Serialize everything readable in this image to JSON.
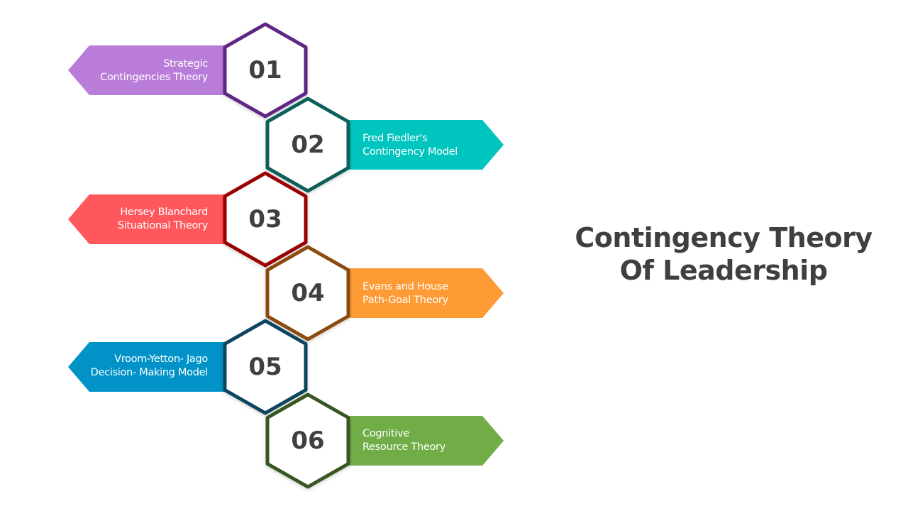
{
  "title": {
    "line1": "Contingency Theory",
    "line2": "Of Leadership",
    "color": "#404040"
  },
  "steps": [
    {
      "number": "01",
      "line1": "Strategic",
      "line2": "Contingencies Theory",
      "side": "left",
      "fill": "#b97cd8",
      "border": "#5f2585"
    },
    {
      "number": "02",
      "line1": "Fred Fiedler's",
      "line2": "Contingency Model",
      "side": "right",
      "fill": "#00c5bf",
      "border": "#0b5e5a"
    },
    {
      "number": "03",
      "line1": "Hersey Blanchard",
      "line2": "Situational Theory",
      "side": "left",
      "fill": "#fe585c",
      "border": "#9b0404"
    },
    {
      "number": "04",
      "line1": "Evans and House",
      "line2": "Path-Goal Theory",
      "side": "right",
      "fill": "#fe9b35",
      "border": "#8a4b0a"
    },
    {
      "number": "05",
      "line1": "Vroom-Yetton- Jago",
      "line2": "Decision- Making Model",
      "side": "left",
      "fill": "#0193c8",
      "border": "#0b4460"
    },
    {
      "number": "06",
      "line1": "Cognitive",
      "line2": "Resource Theory",
      "side": "right",
      "fill": "#70ad47",
      "border": "#375623"
    }
  ]
}
